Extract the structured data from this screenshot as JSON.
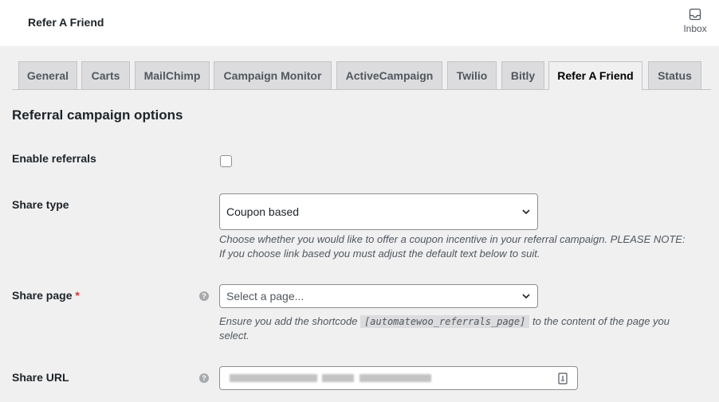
{
  "header": {
    "title": "Refer A Friend",
    "inbox_label": "Inbox"
  },
  "tabs": [
    {
      "label": "General"
    },
    {
      "label": "Carts"
    },
    {
      "label": "MailChimp"
    },
    {
      "label": "Campaign Monitor"
    },
    {
      "label": "ActiveCampaign"
    },
    {
      "label": "Twilio"
    },
    {
      "label": "Bitly"
    },
    {
      "label": "Refer A Friend",
      "active": true
    },
    {
      "label": "Status"
    }
  ],
  "section_title": "Referral campaign options",
  "fields": {
    "enable": {
      "label": "Enable referrals",
      "checked": false
    },
    "share_type": {
      "label": "Share type",
      "value": "Coupon based",
      "description": "Choose whether you would like to offer a coupon incentive in your referral campaign. PLEASE NOTE: If you choose link based you must adjust the default text below to suit."
    },
    "share_page": {
      "label": "Share page",
      "required": "*",
      "placeholder": "Select a page...",
      "desc_before": "Ensure you add the shortcode ",
      "shortcode": "[automatewoo_referrals_page]",
      "desc_after": " to the content of the page you select."
    },
    "share_url": {
      "label": "Share URL"
    }
  }
}
